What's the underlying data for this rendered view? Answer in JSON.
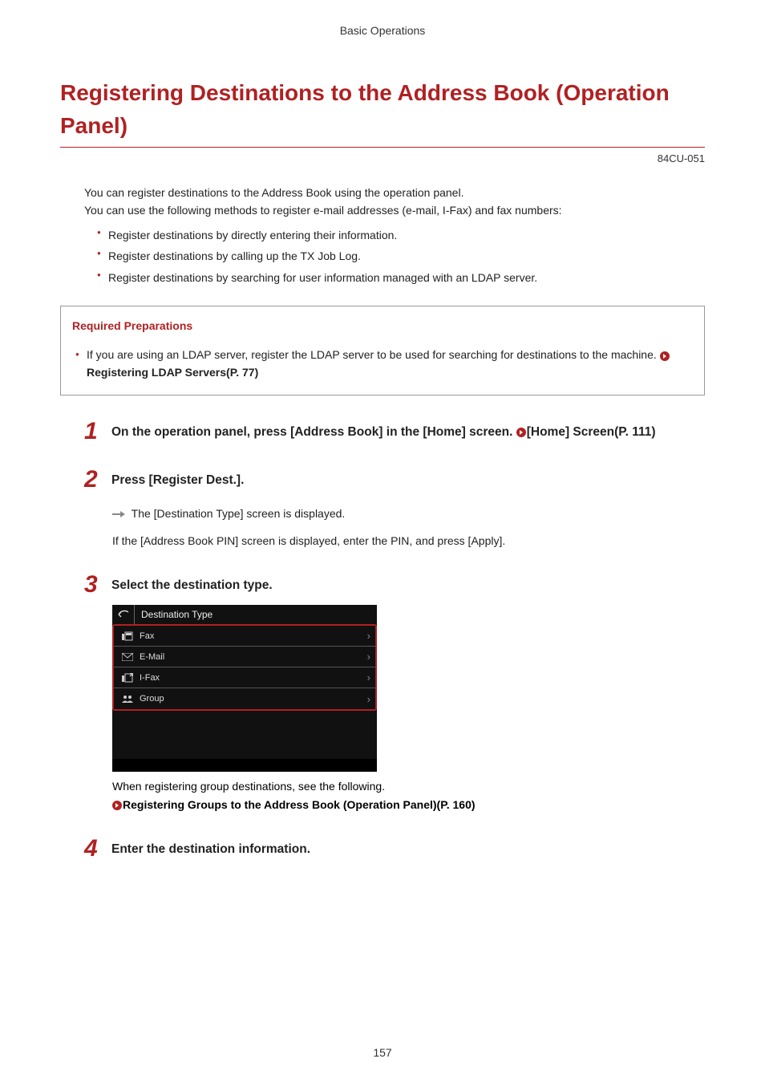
{
  "header": {
    "label": "Basic Operations"
  },
  "title": "Registering Destinations to the Address Book (Operation Panel)",
  "doc_code": "84CU-051",
  "intro": {
    "p1": "You can register destinations to the Address Book using the operation panel.",
    "p2": "You can use the following methods to register e-mail addresses (e-mail, I-Fax) and fax numbers:",
    "bullets": [
      "Register destinations by directly entering their information.",
      "Register destinations by calling up the TX Job Log.",
      "Register destinations by searching for user information managed with an LDAP server."
    ]
  },
  "prep": {
    "heading": "Required Preparations",
    "item_text": "If you are using an LDAP server, register the LDAP server to be used for searching for destinations to the machine. ",
    "link_text": "Registering LDAP Servers(P. 77)"
  },
  "steps": {
    "s1": {
      "num": "1",
      "text_a": "On the operation panel, press [Address Book] in the [Home] screen. ",
      "link": "[Home] Screen(P. 111)"
    },
    "s2": {
      "num": "2",
      "heading": "Press [Register Dest.].",
      "line1": "The [Destination Type] screen is displayed.",
      "line2": "If the [Address Book PIN] screen is displayed, enter the PIN, and press [Apply]."
    },
    "s3": {
      "num": "3",
      "heading": "Select the destination type.",
      "screenshot": {
        "title": "Destination Type",
        "items": [
          "Fax",
          "E-Mail",
          "I-Fax",
          "Group"
        ]
      },
      "caption1": "When registering group destinations, see the following.",
      "caption_link": "Registering Groups to the Address Book (Operation Panel)(P. 160)"
    },
    "s4": {
      "num": "4",
      "heading": "Enter the destination information."
    }
  },
  "page_number": "157"
}
